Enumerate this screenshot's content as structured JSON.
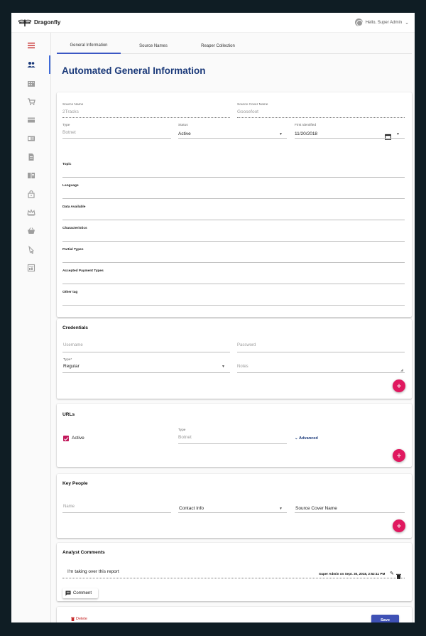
{
  "app": {
    "brand": "Dragonfly",
    "greeting": "Hello, Super Admin"
  },
  "sidebar": {
    "icons": [
      "menu-icon",
      "users-icon",
      "building-icon",
      "cart-icon",
      "credit-card-icon",
      "id-card-icon",
      "document-icon",
      "book-icon",
      "lock-icon",
      "crown-icon",
      "shopping-basket-icon",
      "hand-pointer-icon",
      "chart-list-icon"
    ],
    "active_index": 1,
    "accent": "#c62828"
  },
  "tabs": [
    {
      "label": "General Information",
      "active": true
    },
    {
      "label": "Source Names",
      "active": false
    },
    {
      "label": "Reaper Collection",
      "active": false
    }
  ],
  "page_title": "Automated General Information",
  "general": {
    "source_name": {
      "label": "Source Name",
      "value": "2Tracks"
    },
    "source_cover_name": {
      "label": "Source Cover Name",
      "value": "Goosefoot"
    },
    "type": {
      "label": "Type",
      "value": "Botnet"
    },
    "status": {
      "label": "Status",
      "value": "Active"
    },
    "first_identified": {
      "label": "First Identified",
      "value": "11/20/2018"
    },
    "fields": [
      "Topic",
      "Language",
      "Data Available",
      "Characteristics",
      "Partial Types",
      "Accepted Payment Types",
      "Other tag"
    ]
  },
  "credentials": {
    "title": "Credentials",
    "username_placeholder": "Username",
    "password_placeholder": "Password",
    "type_label": "Type*",
    "type_value": "Regular",
    "notes_placeholder": "Notes"
  },
  "urls": {
    "title": "URLs",
    "active_label": "Active",
    "type_label": "Type",
    "type_value": "Botnet",
    "advanced_label": "Advanced"
  },
  "key_people": {
    "title": "Key People",
    "name_placeholder": "Name",
    "contact_info": "Contact Info",
    "source_cover_name": "Source Cover Name"
  },
  "comments": {
    "title": "Analyst Comments",
    "text": "I'm taking over this report",
    "meta": "Super Admin on Sept. 30, 2018, 2:52:11 PM",
    "button_label": "Comment"
  },
  "footer": {
    "delete_label": "Delete",
    "save_label": "Save"
  },
  "colors": {
    "primary": "#3f51b5",
    "fab": "#e0185f",
    "title": "#1b3a7a",
    "delete": "#c62828"
  }
}
